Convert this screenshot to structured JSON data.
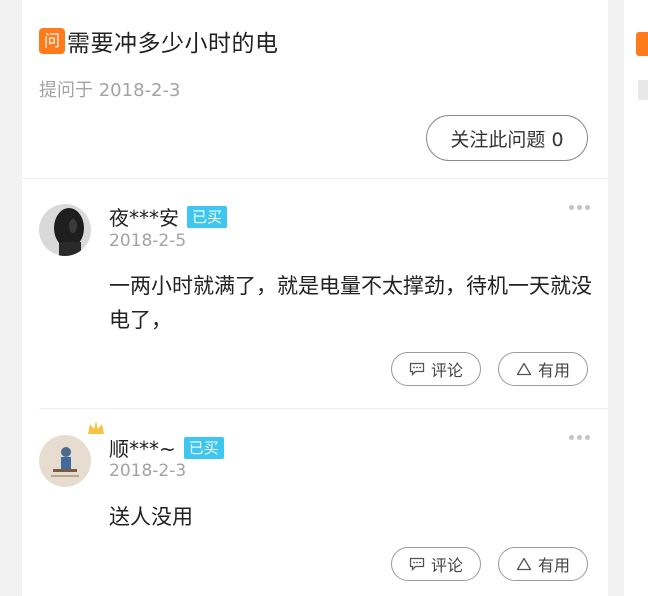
{
  "question": {
    "badge": "问",
    "title": "需要冲多少小时的电",
    "date": "提问于 2018-2-3",
    "follow_label": "关注此问题 0"
  },
  "answers": [
    {
      "user": "夜***安",
      "badge": "已买",
      "date": "2018-2-5",
      "text": "一两小时就满了，就是电量不太撑劲，待机一天就没电了，",
      "comment_label": "评论",
      "useful_label": "有用"
    },
    {
      "user": "顺***~",
      "badge": "已买",
      "date": "2018-2-3",
      "text": "送人没用",
      "comment_label": "评论",
      "useful_label": "有用"
    }
  ],
  "colors": {
    "accent": "#ff7a1a",
    "bought_badge": "#3cc6f0"
  },
  "icons": [
    "more-dots-icon",
    "comment-icon",
    "triangle-useful-icon"
  ]
}
